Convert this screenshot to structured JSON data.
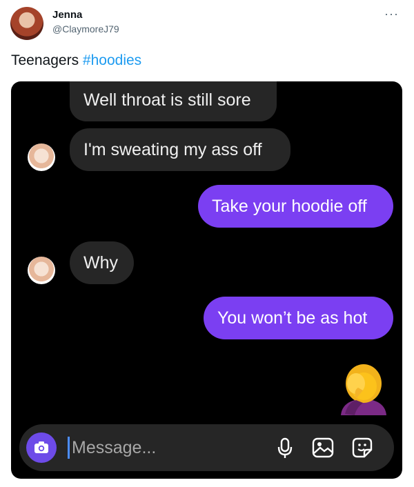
{
  "tweet": {
    "display_name": "Jenna",
    "handle": "@ClaymoreJ79",
    "more_label": "···",
    "text": "Teenagers",
    "hashtag": "#hoodies"
  },
  "chat": {
    "messages": [
      {
        "sender": "them",
        "text": "Well throat is still sore"
      },
      {
        "sender": "them",
        "text": "I'm sweating my ass off"
      },
      {
        "sender": "me",
        "text": "Take your hoodie off"
      },
      {
        "sender": "them",
        "text": "Why"
      },
      {
        "sender": "me",
        "text": "You won’t be as hot"
      }
    ],
    "reaction_emoji": "facepalm-emoji",
    "composer": {
      "placeholder": "Message...",
      "icons": [
        "camera-icon",
        "microphone-icon",
        "image-icon",
        "sticker-icon"
      ]
    }
  },
  "colors": {
    "hashtag": "#1d9bf0",
    "outgoing_bubble": "#7b3ff2",
    "incoming_bubble": "#262626",
    "camera_button": "#6d4be8",
    "chat_background": "#000000"
  }
}
